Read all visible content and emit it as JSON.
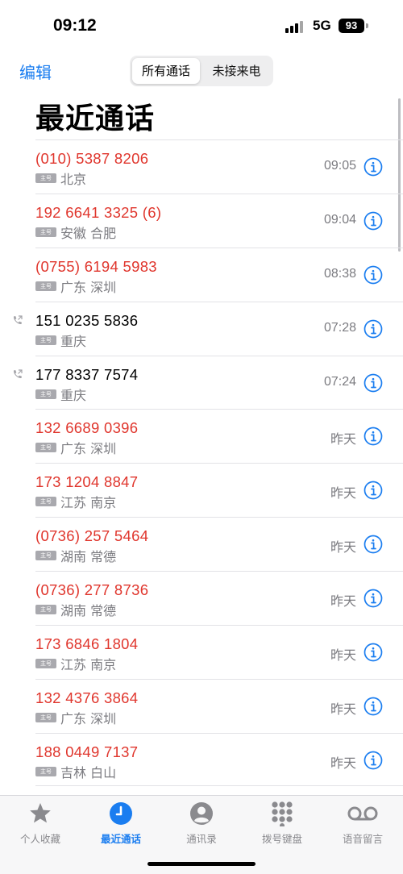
{
  "status": {
    "time": "09:12",
    "network": "5G",
    "battery": "93"
  },
  "header": {
    "edit_label": "编辑",
    "segments": [
      {
        "label": "所有通话",
        "selected": true
      },
      {
        "label": "未接来电",
        "selected": false
      }
    ],
    "title": "最近通话"
  },
  "colors": {
    "accent": "#1a7df0",
    "missed": "#e0362d"
  },
  "calls": [
    {
      "number": "(010) 5387 8206",
      "tag": "主号",
      "location": "北京",
      "time": "09:05",
      "missed": true,
      "outgoing": false
    },
    {
      "number": "192 6641 3325 (6)",
      "tag": "主号",
      "location": "安徽 合肥",
      "time": "09:04",
      "missed": true,
      "outgoing": false
    },
    {
      "number": "(0755) 6194 5983",
      "tag": "主号",
      "location": "广东 深圳",
      "time": "08:38",
      "missed": true,
      "outgoing": false
    },
    {
      "number": "151 0235 5836",
      "tag": "主号",
      "location": "重庆",
      "time": "07:28",
      "missed": false,
      "outgoing": true
    },
    {
      "number": "177 8337 7574",
      "tag": "主号",
      "location": "重庆",
      "time": "07:24",
      "missed": false,
      "outgoing": true
    },
    {
      "number": "132 6689 0396",
      "tag": "主号",
      "location": "广东 深圳",
      "time": "昨天",
      "missed": true,
      "outgoing": false
    },
    {
      "number": "173 1204 8847",
      "tag": "主号",
      "location": "江苏 南京",
      "time": "昨天",
      "missed": true,
      "outgoing": false
    },
    {
      "number": "(0736) 257 5464",
      "tag": "主号",
      "location": "湖南 常德",
      "time": "昨天",
      "missed": true,
      "outgoing": false
    },
    {
      "number": "(0736) 277 8736",
      "tag": "主号",
      "location": "湖南 常德",
      "time": "昨天",
      "missed": true,
      "outgoing": false
    },
    {
      "number": "173 6846 1804",
      "tag": "主号",
      "location": "江苏 南京",
      "time": "昨天",
      "missed": true,
      "outgoing": false
    },
    {
      "number": "132 4376 3864",
      "tag": "主号",
      "location": "广东 深圳",
      "time": "昨天",
      "missed": true,
      "outgoing": false
    },
    {
      "number": "188 0449 7137",
      "tag": "主号",
      "location": "吉林 白山",
      "time": "昨天",
      "missed": true,
      "outgoing": false
    }
  ],
  "tabs": [
    {
      "label": "个人收藏",
      "icon": "star-icon",
      "active": false
    },
    {
      "label": "最近通话",
      "icon": "clock-icon",
      "active": true
    },
    {
      "label": "通讯录",
      "icon": "contacts-icon",
      "active": false
    },
    {
      "label": "拨号键盘",
      "icon": "keypad-icon",
      "active": false
    },
    {
      "label": "语音留言",
      "icon": "voicemail-icon",
      "active": false
    }
  ]
}
